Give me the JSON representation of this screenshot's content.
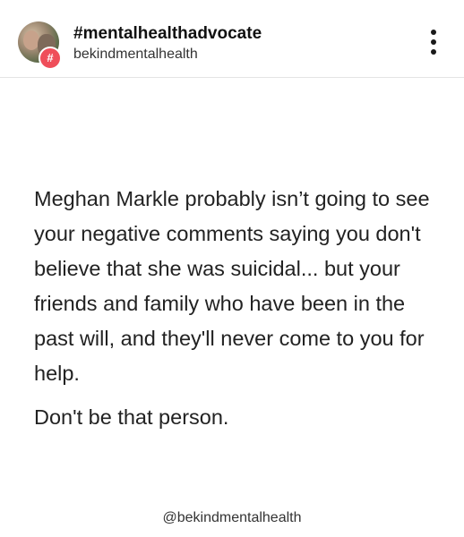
{
  "header": {
    "account_name": "#mentalhealthadvocate",
    "account_handle": "bekindmentalhealth",
    "badge_symbol": "#",
    "badge_color": "#ef4e5a",
    "more_icon": "more-vertical-icon"
  },
  "post": {
    "body": "Meghan Markle probably isn’t going to see your negative comments saying you don't believe that she was suicidal... but your friends and family who have been in the past will, and they'll never come to you for help.",
    "closing": "Don't be that person."
  },
  "footer": {
    "watermark": "@bekindmentalhealth"
  }
}
